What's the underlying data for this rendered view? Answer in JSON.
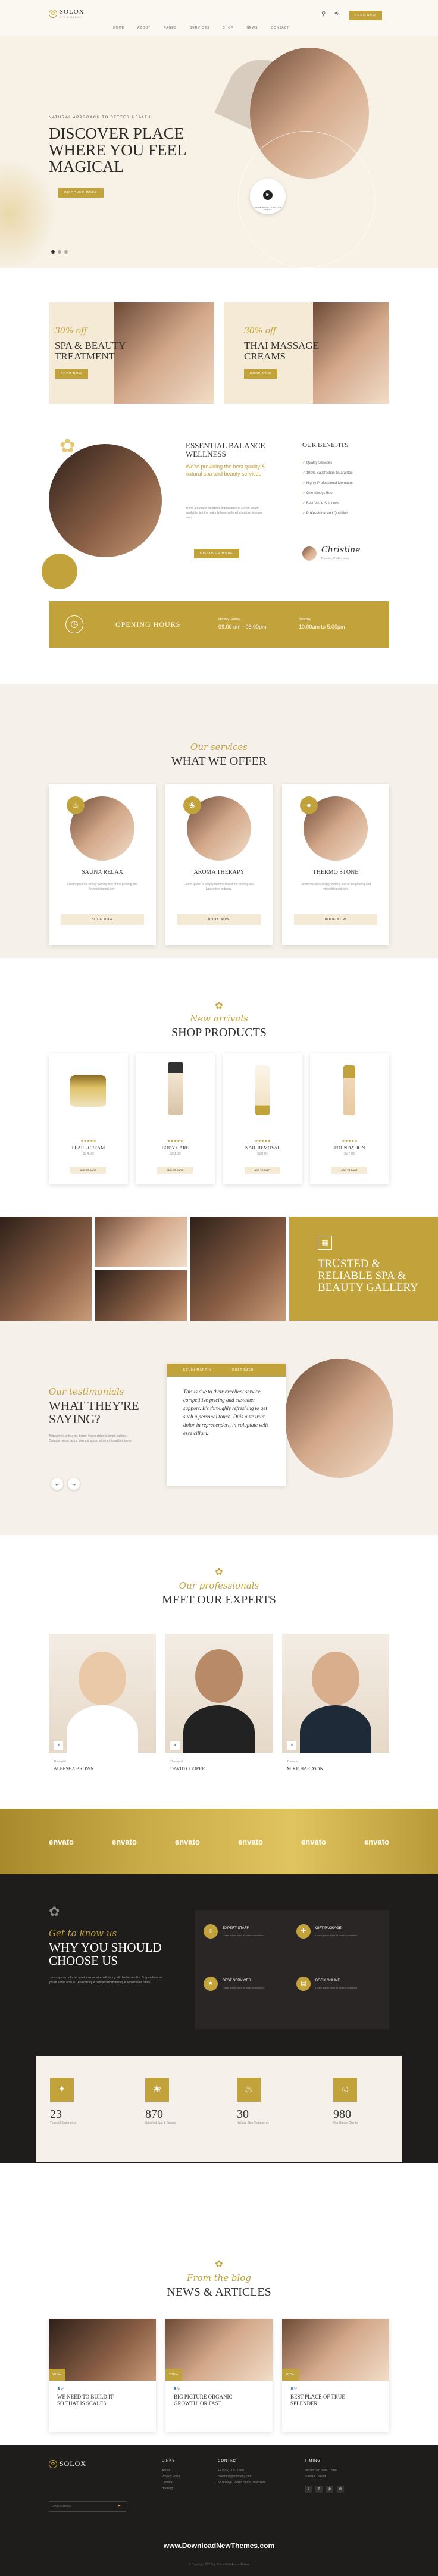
{
  "colors": {
    "accent": "#c2a23a",
    "dark": "#1f1c1c",
    "cream": "#f6f1e7"
  },
  "header": {
    "logo": "SOLOX",
    "logo_sub": "SPA & BEAUTY",
    "nav": [
      "HOME",
      "ABOUT",
      "PAGES",
      "SERVICES",
      "SHOP",
      "NEWS",
      "CONTACT"
    ],
    "cta": "BOOK NOW"
  },
  "hero": {
    "eyebrow": "NATURAL APPROACH TO BETTER HEALTH",
    "title_l1": "DISCOVER PLACE",
    "title_l2": "WHERE YOU FEEL",
    "title_l3": "MAGICAL",
    "button": "DISCOVER MORE",
    "badge": "SPA & BEAUTY • WATCH VIDEO •"
  },
  "promos": [
    {
      "pct": "30% off",
      "title_l1": "SPA & BEAUTY",
      "title_l2": "TREATMENT",
      "button": "BOOK NOW"
    },
    {
      "pct": "30% off",
      "title_l1": "THAI MASSAGE",
      "title_l2": "CREAMS",
      "button": "BOOK NOW"
    }
  ],
  "about": {
    "title_l1": "ESSENTIAL BALANCE",
    "title_l2": "WELLNESS",
    "lead": "We're providing the best quality & natural spa and beauty services",
    "body": "There are many variations of passages of Lorem Ipsum available, but the majority have suffered alteration in some form.",
    "button": "DISCOVER MORE",
    "benefits_title": "OUR BENEFITS",
    "benefits": [
      "Quality Services",
      "100% Satisfaction Guarantee",
      "Highly Professional Members",
      "One Always Best",
      "Best Value Solutions",
      "Professional and Qualified"
    ],
    "signature": "Christine",
    "signature_role": "Director, Co-Founder"
  },
  "hours": {
    "label": "OPENING HOURS",
    "days1": "Monday - Friday",
    "time1": "09.00 am - 08.00pm",
    "days2": "Saturday",
    "time2": "10.00am to 5.00pm"
  },
  "offer": {
    "script": "Our services",
    "title": "WHAT WE OFFER",
    "items": [
      {
        "name": "SAUNA RELAX",
        "desc": "Lorem Ipsum is simply dummy text of the printing and typesetting industry.",
        "button": "BOOK NOW"
      },
      {
        "name": "AROMA THERAPY",
        "desc": "Lorem Ipsum is simply dummy text of the printing and typesetting industry.",
        "button": "BOOK NOW"
      },
      {
        "name": "THERMO STONE",
        "desc": "Lorem Ipsum is simply dummy text of the printing and typesetting industry.",
        "button": "BOOK NOW"
      }
    ]
  },
  "shop": {
    "script": "New arrivals",
    "title": "SHOP PRODUCTS",
    "products": [
      {
        "name": "PEARL CREAM",
        "price": "$14.00",
        "stars": "★★★★★",
        "button": "ADD TO CART"
      },
      {
        "name": "BODY CARE",
        "price": "$29.00",
        "stars": "★★★★★",
        "button": "ADD TO CART"
      },
      {
        "name": "NAIL REMOVAL",
        "price": "$20.00",
        "stars": "★★★★★",
        "button": "ADD TO CART"
      },
      {
        "name": "FOUNDATION",
        "price": "$27.00",
        "stars": "★★★★★",
        "button": "ADD TO CART"
      }
    ]
  },
  "gallery": {
    "title_l1": "TRUSTED &",
    "title_l2": "RELIABLE SPA &",
    "title_l3": "BEAUTY GALLERY"
  },
  "testimonial": {
    "script": "Our testimonials",
    "title_l1": "WHAT THEY'RE",
    "title_l2": "SAYING?",
    "body": "Aliquam vel ante a mi. Lorem ipsum dolor sit amet, facilisis. Quisque neque luctus lorem at auctor sit amet, curabitur lorem.",
    "name": "KEVIN MARTIN",
    "role": "CUSTOMER",
    "quote": "This is due to their excellent service, competitive pricing and customer support. It's throughly refreshing to get such a personal touch. Duis aute irure dolor in reprehenderit in voluptate velit esse cillum."
  },
  "experts": {
    "script": "Our professionals",
    "title": "MEET OUR EXPERTS",
    "people": [
      {
        "role": "Therapist",
        "name": "ALEESHA BROWN"
      },
      {
        "role": "Therapist",
        "name": "DAVID COOPER"
      },
      {
        "role": "Therapist",
        "name": "MIKE HARDSON"
      }
    ]
  },
  "brands": [
    "envato",
    "envato",
    "envato",
    "envato",
    "envato",
    "envato"
  ],
  "why": {
    "script": "Get to know us",
    "title_l1": "WHY YOU SHOULD",
    "title_l2": "CHOOSE US",
    "body": "Lorem ipsum dolor sit amet, consectetur adipiscing elit. Nullam mollis. Suspendisse ut ipsum luctus ante eu. Pellentesque habitant morbi tristique senectus et netus.",
    "features": [
      {
        "title": "EXPERT STAFF",
        "desc": "Lorem ipsum dolor sit amet consectetur."
      },
      {
        "title": "GIFT PACKAGE",
        "desc": "Lorem ipsum dolor sit amet consectetur."
      },
      {
        "title": "BEST SERVICES",
        "desc": "Lorem ipsum dolor sit amet consectetur."
      },
      {
        "title": "BOOK ONLINE",
        "desc": "Lorem ipsum dolor sit amet consectetur."
      }
    ]
  },
  "stats": [
    {
      "value": "23",
      "label": "Years of Experience"
    },
    {
      "value": "870",
      "label": "Satisfied Spa & Beauty"
    },
    {
      "value": "30",
      "label": "Natural Skin Treatments"
    },
    {
      "value": "980",
      "label": "Our Happy Clients"
    }
  ],
  "news": {
    "script": "From the blog",
    "title": "NEWS & ARTICLES",
    "posts": [
      {
        "date": "20 Dec",
        "title_l1": "WE NEED TO BUILD IT",
        "title_l2": "SO THAT IS SCALES"
      },
      {
        "date": "20 Dec",
        "title_l1": "BIG PICTURE ORGANIC",
        "title_l2": "GROWTH, OR FAST"
      },
      {
        "date": "20 Dec",
        "title_l1": "BEST PLACE OF TRUE",
        "title_l2": "SPLENDER"
      }
    ]
  },
  "footer": {
    "logo": "SOLOX",
    "links_title": "LINKS",
    "links": [
      "About",
      "Privacy Policy",
      "Contact",
      "Booking"
    ],
    "contact_title": "CONTACT",
    "contact": [
      "+1 (555) 000 - 0000",
      "needhelp@company.com",
      "88 Broklyn Golden Street, New York"
    ],
    "timing_title": "TIMING",
    "timing": [
      "Mon to Sat: 9:00 - 18:00",
      "Sunday: Closed"
    ],
    "newsletter_placeholder": "Email Address",
    "watermark": "www.DownloadNewThemes.com",
    "copyright": "© Copyright 2023 by Solox WordPress Theme"
  }
}
